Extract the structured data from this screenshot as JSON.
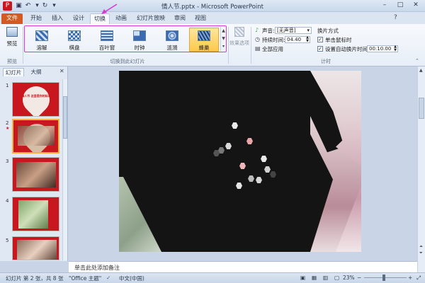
{
  "window": {
    "title": "情人节.pptx - Microsoft PowerPoint"
  },
  "tabs": [
    "文件",
    "开始",
    "插入",
    "设计",
    "切换",
    "动画",
    "幻灯片放映",
    "审阅",
    "视图"
  ],
  "ribbon": {
    "preview": {
      "label": "预览",
      "group": "预览"
    },
    "transitions": [
      "溶解",
      "棋盘",
      "百叶窗",
      "时钟",
      "涟漪",
      "蜂巢"
    ],
    "transitions_group": "切换到此幻灯片",
    "effect_options": "效果选项",
    "timing": {
      "sound_label": "声音:",
      "sound_value": "[无声音]",
      "duration_label": "持续时间:",
      "duration_value": "04.40",
      "apply_all": "全部应用",
      "advance_title": "换片方式",
      "on_click": "单击鼠标时",
      "on_click_checked": true,
      "after_label": "设置自动换片时间:",
      "after_checked": true,
      "after_value": "00:10.00",
      "group": "计时"
    }
  },
  "panel": {
    "tabs": [
      "幻灯片",
      "大纲"
    ],
    "slides": [
      {
        "num": "1",
        "title_text": "情人节 这里是你的标语"
      },
      {
        "num": "2"
      },
      {
        "num": "3"
      },
      {
        "num": "4"
      },
      {
        "num": "5"
      }
    ]
  },
  "notes": {
    "placeholder": "单击此处添加备注"
  },
  "status": {
    "slide_info": "幻灯片 第 2 张，共 8 张",
    "theme": "\"Office 主题\"",
    "language": "中文(中国)",
    "zoom": "23%"
  },
  "colors": {
    "file_tab": "#d35a20",
    "selected_gallery": "#ffc94a",
    "annotation": "#d63ad6"
  }
}
